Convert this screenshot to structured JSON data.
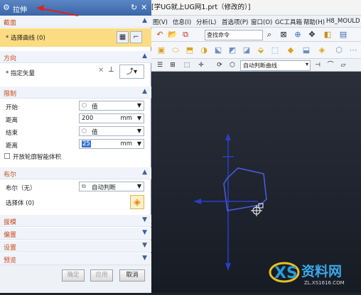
{
  "dialog": {
    "title": "拉伸",
    "section_profile": "截面",
    "select_curve": "* 选择曲线 (0)",
    "section_direction": "方向",
    "specify_vector": "* 指定矢量",
    "section_limits": "限制",
    "start_label": "开始",
    "start_value": "值",
    "start_distance_label": "距离",
    "start_distance": "200",
    "start_unit": "mm",
    "end_label": "结束",
    "end_value": "值",
    "end_distance_label": "距离",
    "end_distance": "25",
    "end_unit": "mm",
    "open_profile": "开放轮廓智能体积",
    "section_boolean": "布尔",
    "boolean_label": "布尔（无）",
    "boolean_value": "自动判断",
    "select_body": "选择体 (0)",
    "section_draft": "拔模",
    "section_offset": "偏置",
    "section_settings": "设置",
    "section_preview": "预览",
    "ok": "确定",
    "apply": "应用",
    "cancel": "取消"
  },
  "app": {
    "file_title": "[学UG就上UG网1.prt（修改的）]",
    "menus": [
      "图(V)",
      "信息(I)",
      "分析(L)",
      "首选项(P)",
      "窗口(O)",
      "GC工具箱",
      "帮助(H)",
      "H8_MOULD"
    ],
    "search_placeholder": "查找命令",
    "filter_value": "自动判断曲线"
  },
  "watermark": {
    "text": "资料网",
    "url": "ZL.XS1616.COM"
  }
}
